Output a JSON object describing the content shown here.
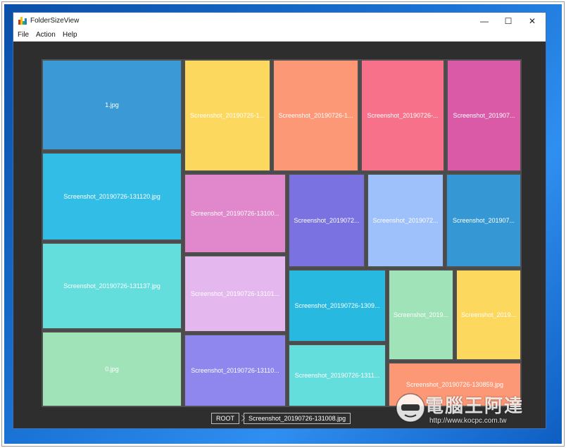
{
  "window": {
    "title": "FolderSizeView"
  },
  "menu": [
    "File",
    "Action",
    "Help"
  ],
  "tiles": [
    {
      "label": "1.jpg",
      "color": "#3b9ad6"
    },
    {
      "label": "Screenshot_20190726-131120.jpg",
      "color": "#31bde6"
    },
    {
      "label": "Screenshot_20190726-131137.jpg",
      "color": "#64dedd"
    },
    {
      "label": "0.jpg",
      "color": "#a1e3b9"
    },
    {
      "label": "Screenshot_20190726-1...",
      "color": "#fdd85e"
    },
    {
      "label": "Screenshot_20190726-1...",
      "color": "#fd9876"
    },
    {
      "label": "Screenshot_20190726-...",
      "color": "#f8718b"
    },
    {
      "label": "Screenshot_201907...",
      "color": "#da5aa8"
    },
    {
      "label": "Screenshot_20190726-13100...",
      "color": "#e187cb"
    },
    {
      "label": "Screenshot_2019072...",
      "color": "#7a72e0"
    },
    {
      "label": "Screenshot_2019072...",
      "color": "#9ec1fb"
    },
    {
      "label": "Screenshot_201907...",
      "color": "#3598d5"
    },
    {
      "label": "Screenshot_20190726-13101...",
      "color": "#e4b8ee"
    },
    {
      "label": "Screenshot_20190726-1309...",
      "color": "#28b9e0"
    },
    {
      "label": "Screenshot_2019...",
      "color": "#a1e3b9"
    },
    {
      "label": "Screenshot_2019...",
      "color": "#fdd85e"
    },
    {
      "label": "Screenshot_20190726-13110...",
      "color": "#8f86ee"
    },
    {
      "label": "Screenshot_20190726-1311...",
      "color": "#64dedd"
    },
    {
      "label": "Screenshot_20190726-130859.jpg",
      "color": "#fd9876"
    }
  ],
  "breadcrumb": {
    "root": "ROOT",
    "current": "Screenshot_20190726-131008.jpg"
  },
  "watermark": {
    "text": "電腦王阿達",
    "url": "http://www.kocpc.com.tw"
  }
}
